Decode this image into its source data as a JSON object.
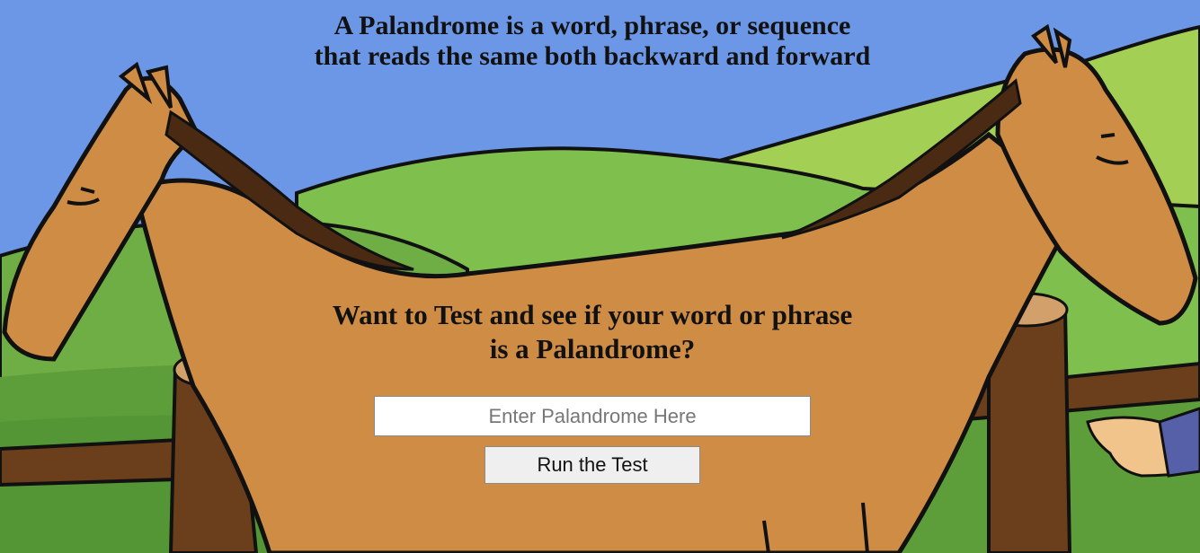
{
  "header": {
    "line1": "A Palandrome is a word, phrase, or sequence",
    "line2": "that reads the same both backward and forward"
  },
  "prompt": {
    "line1": "Want to Test and see if your word or phrase",
    "line2": "is a Palandrome?"
  },
  "form": {
    "input_value": "",
    "input_placeholder": "Enter Palandrome Here",
    "button_label": "Run the Test"
  },
  "background": {
    "description_icon": "two-headed-horse-illustration",
    "colors": {
      "sky": "#6b97e6",
      "hill_light": "#8cc151",
      "hill_dark": "#5e9e3a",
      "horse": "#cf8c45",
      "mane": "#4a2a12",
      "fence": "#6b3f1c",
      "outline": "#1a1208"
    }
  }
}
